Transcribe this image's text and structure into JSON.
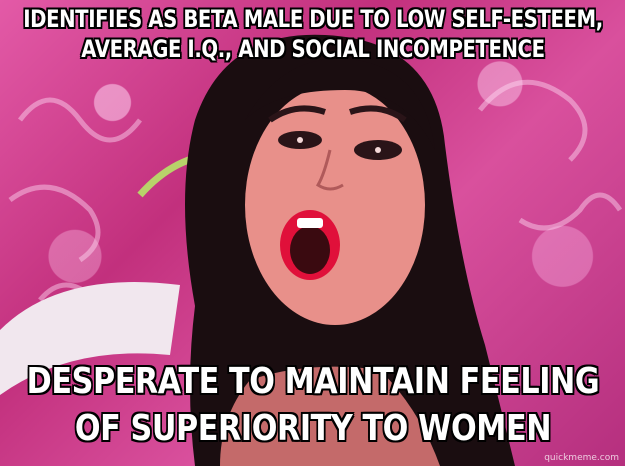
{
  "meme": {
    "top_text": "IDENTIFIES AS BETA MALE DUE TO LOW SELF-ESTEEM, AVERAGE I.Q., AND SOCIAL INCOMPETENCE",
    "bottom_text": "DESPERATE TO MAINTAIN FEELING OF SUPERIORITY TO WOMEN",
    "watermark": "quickmeme.com"
  },
  "colors": {
    "background_pink": "#d23f8f",
    "hair": "#1a0d10",
    "skin": "#e8908a",
    "text": "#ffffff",
    "text_outline": "#000000"
  }
}
